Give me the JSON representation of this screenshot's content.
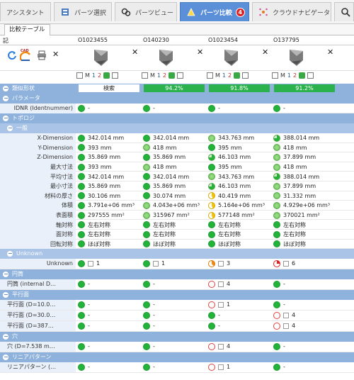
{
  "tabs": [
    {
      "label": "アシスタント",
      "icon": "assistant-icon"
    },
    {
      "label": "パーツ選択",
      "icon": "parts-select-icon"
    },
    {
      "label": "パーツビュー",
      "icon": "parts-view-icon"
    },
    {
      "label": "パーツ比較",
      "icon": "parts-compare-icon",
      "badge": "4",
      "active": true
    },
    {
      "label": "クラウドナビゲータ",
      "icon": "cloud-navigator-icon"
    }
  ],
  "subtab": "比較テーブル",
  "idrow": {
    "label": "記",
    "ids": [
      "O1023455",
      "O140230",
      "O1023454",
      "O137795"
    ]
  },
  "mini_toolbar": {
    "m": "M",
    "one": "1",
    "two": "2"
  },
  "similarity": {
    "label": "類似形状",
    "values": [
      "検索",
      "94.2%",
      "91.8%",
      "91.2%"
    ]
  },
  "sections": {
    "params": "パラメータ",
    "topology": "トポロジ",
    "general": "一般",
    "unknown": "Unknown",
    "cylinder": "円筒",
    "plane": "平行面",
    "hole": "穴",
    "linear": "リニアパターン"
  },
  "idnr": {
    "label": "IDNR (Identnummer)",
    "values": [
      "-",
      "-",
      "-",
      "-"
    ]
  },
  "general_rows": [
    {
      "label": "X-Dimension",
      "values": [
        "342.014 mm",
        "342.014 mm",
        "343.763 mm",
        "388.014 mm"
      ],
      "status": [
        "g",
        "g",
        "lg",
        "pg"
      ]
    },
    {
      "label": "Y-Dimension",
      "values": [
        "393 mm",
        "418 mm",
        "395 mm",
        "418 mm"
      ],
      "status": [
        "g",
        "lg",
        "g",
        "lg"
      ]
    },
    {
      "label": "Z-Dimension",
      "values": [
        "35.869 mm",
        "35.869 mm",
        "46.103 mm",
        "37.899 mm"
      ],
      "status": [
        "g",
        "g",
        "pg",
        "lg"
      ]
    },
    {
      "label": "最大寸法",
      "values": [
        "393 mm",
        "418 mm",
        "395 mm",
        "418 mm"
      ],
      "status": [
        "g",
        "lg",
        "g",
        "lg"
      ]
    },
    {
      "label": "平均寸法",
      "values": [
        "342.014 mm",
        "342.014 mm",
        "343.763 mm",
        "388.014 mm"
      ],
      "status": [
        "g",
        "g",
        "lg",
        "pg"
      ]
    },
    {
      "label": "最小寸法",
      "values": [
        "35.869 mm",
        "35.869 mm",
        "46.103 mm",
        "37.899 mm"
      ],
      "status": [
        "g",
        "g",
        "pg",
        "lg"
      ]
    },
    {
      "label": "材料の厚さ",
      "values": [
        "30.106 mm",
        "30.074 mm",
        "40.419 mm",
        "31.332 mm"
      ],
      "status": [
        "g",
        "g",
        "y",
        "lg"
      ]
    },
    {
      "label": "体積",
      "values": [
        "3.791e+06 mm³",
        "4.043e+06 mm³",
        "5.164e+06 mm³",
        "4.929e+06 mm³"
      ],
      "status": [
        "g",
        "lg",
        "y",
        "lg"
      ]
    },
    {
      "label": "表面積",
      "values": [
        "297555 mm²",
        "315967 mm²",
        "577148 mm²",
        "370021 mm²"
      ],
      "status": [
        "g",
        "lg",
        "y",
        "lg"
      ]
    },
    {
      "label": "軸対称",
      "values": [
        "左右対称",
        "左右対称",
        "左右対称",
        "左右対称"
      ],
      "status": [
        "g",
        "g",
        "g",
        "g"
      ]
    },
    {
      "label": "面対称",
      "values": [
        "左右対称",
        "左右対称",
        "左右対称",
        "左右対称"
      ],
      "status": [
        "g",
        "g",
        "g",
        "g"
      ]
    },
    {
      "label": "回転対称",
      "values": [
        "ほぼ対称",
        "ほぼ対称",
        "ほぼ対称",
        "ほぼ対称"
      ],
      "status": [
        "g",
        "g",
        "g",
        "g"
      ]
    }
  ],
  "unknown_row": {
    "label": "Unknown",
    "values": [
      "1",
      "1",
      "3",
      "6"
    ],
    "status": [
      "g",
      "g",
      "o",
      "r"
    ]
  },
  "cylinder_row": {
    "label": "円筒 (internal D…",
    "values": [
      "-",
      "-",
      "4",
      "-"
    ],
    "status": [
      "g",
      "g",
      "e",
      "g"
    ]
  },
  "plane_rows": [
    {
      "label": "平行面 (D=10.0…",
      "values": [
        "-",
        "-",
        "1",
        "-"
      ],
      "status": [
        "g",
        "g",
        "e",
        "g"
      ]
    },
    {
      "label": "平行面 (D=30.0…",
      "values": [
        "-",
        "-",
        "-",
        "4"
      ],
      "status": [
        "g",
        "g",
        "g",
        "e"
      ]
    },
    {
      "label": "平行面 (D=387…",
      "values": [
        "-",
        "-",
        "-",
        "4"
      ],
      "status": [
        "g",
        "g",
        "g",
        "e"
      ]
    }
  ],
  "hole_row": {
    "label": "穴 (D=7.538 m…",
    "values": [
      "-",
      "-",
      "4",
      "-"
    ],
    "status": [
      "g",
      "g",
      "e",
      "g"
    ]
  },
  "linear_row": {
    "label": "リニアパターン (…",
    "values": [
      "-",
      "-",
      "1",
      "-"
    ],
    "status": [
      "g",
      "g",
      "e",
      "g"
    ]
  },
  "colors": {
    "accent": "#5b8fd8",
    "section": "#8eb2dc",
    "match": "#23b33a",
    "mismatch": "#e04040"
  }
}
